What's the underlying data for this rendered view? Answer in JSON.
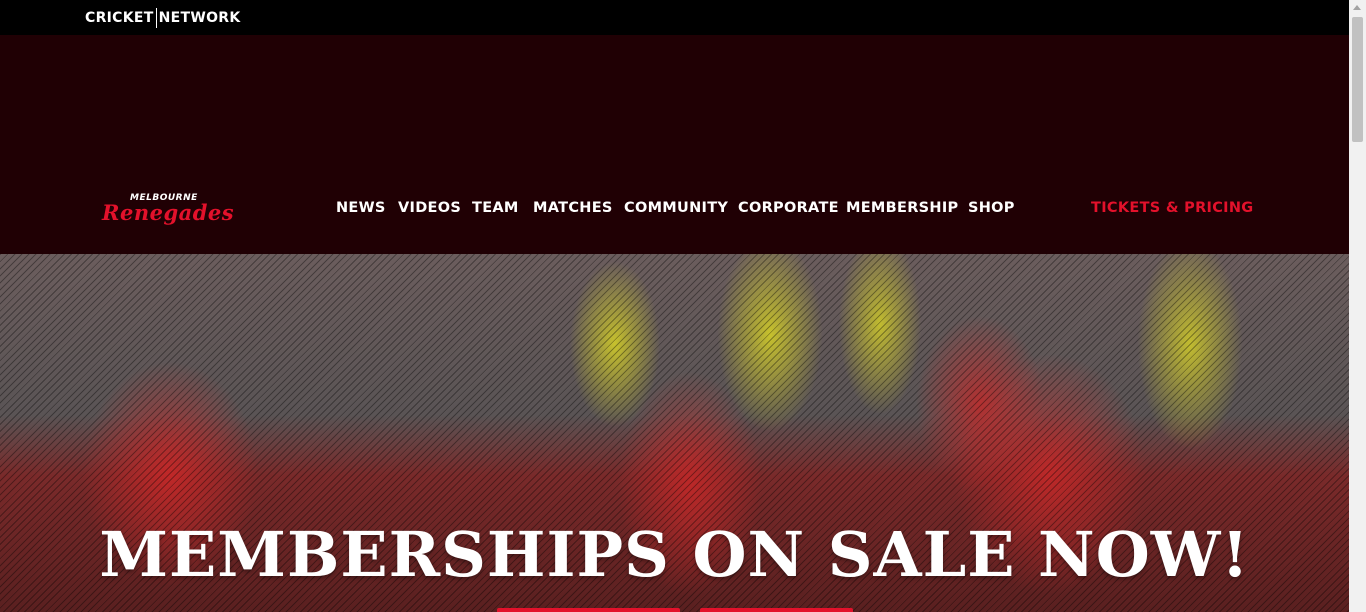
{
  "topbar": {
    "logo_left": "CRICKET",
    "logo_right": "NETWORK"
  },
  "brand": {
    "line1": "MELBOURNE",
    "line2": "Renegades"
  },
  "nav": {
    "items": [
      "NEWS",
      "VIDEOS",
      "TEAM",
      "MATCHES",
      "COMMUNITY",
      "CORPORATE",
      "MEMBERSHIP",
      "SHOP"
    ],
    "tickets": "TICKETS & PRICING"
  },
  "hero": {
    "title": "MEMBERSHIPS ON SALE NOW!"
  },
  "colors": {
    "brand_red": "#e3112b",
    "header_bg": "#200004",
    "topbar_bg": "#000000"
  }
}
